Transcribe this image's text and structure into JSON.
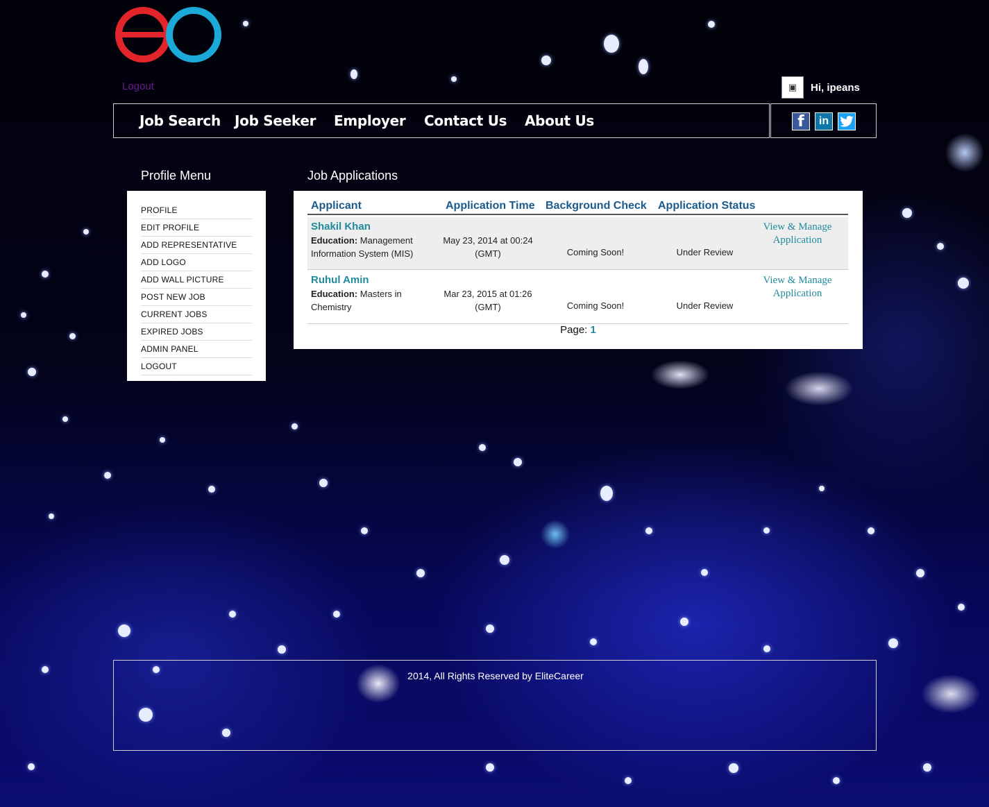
{
  "header": {
    "logout_link": "Logout",
    "greeting": "Hi, ipeans",
    "avatar_icon": "broken-image-icon"
  },
  "nav": {
    "items": [
      "Job Search",
      "Job Seeker",
      "Employer",
      "Contact Us",
      "About Us"
    ]
  },
  "social": {
    "facebook": "f",
    "linkedin": "in",
    "twitter": "t"
  },
  "profile_menu": {
    "title": "Profile Menu",
    "items": [
      "PROFILE",
      "EDIT PROFILE",
      "ADD REPRESENTATIVE",
      "ADD LOGO",
      "ADD WALL PICTURE",
      "POST NEW JOB",
      "CURRENT JOBS",
      "EXPIRED JOBS",
      "ADMIN PANEL",
      "LOGOUT"
    ]
  },
  "applications": {
    "title": "Job Applications",
    "columns": [
      "Applicant",
      "Application Time",
      "Background Check",
      "Application Status"
    ],
    "education_label": "Education:",
    "rows": [
      {
        "name": "Shakil Khan",
        "education": "Management Information System (MIS)",
        "time": "May 23, 2014 at 00:24 (GMT)",
        "background": "Coming Soon!",
        "status": "Under Review",
        "action": "View & Manage Application"
      },
      {
        "name": "Ruhul Amin",
        "education": "Masters in Chemistry",
        "time": "Mar 23, 2015 at 01:26 (GMT)",
        "background": "Coming Soon!",
        "status": "Under Review",
        "action": "View & Manage Application"
      }
    ],
    "page_label": "Page:",
    "page_number": "1"
  },
  "footer": {
    "text": "2014, All Rights Reserved by EliteCareer"
  },
  "colors": {
    "logo_red": "#e3242b",
    "logo_blue": "#1ba9d8",
    "link_teal": "#1f8a9c",
    "header_blue": "#1a5a8c",
    "logout_purple": "#6a1b8a"
  }
}
